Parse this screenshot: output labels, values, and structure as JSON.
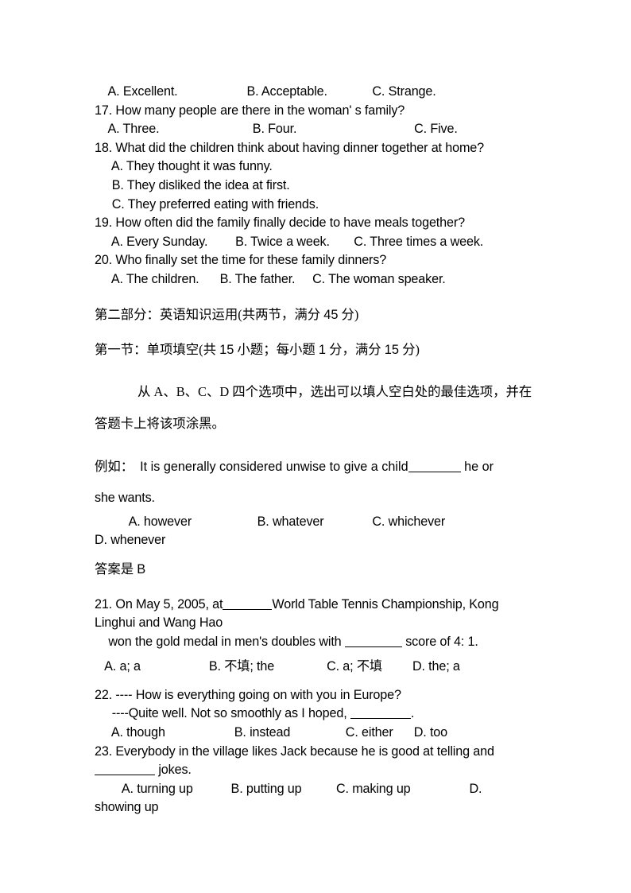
{
  "document": {
    "listening_tail": {
      "q16_options": "    A. Excellent.                    B. Acceptable.             C. Strange.",
      "q17_stem": "17. How many people are there in the woman' s family?",
      "q17_options": "    A. Three.                           B. Four.                                  C. Five.",
      "q18_stem": "18. What did the children think about having dinner together at home?",
      "q18_option_a": "     A. They thought it was funny.",
      "q18_option_b": "     B. They disliked the idea at first.",
      "q18_option_c": "     C. They preferred eating with friends.",
      "q19_stem": "19. How often did the family finally decide to have meals together?",
      "q19_options": "     A. Every Sunday.        B. Twice a week.       C. Three times a week.",
      "q20_stem": "20. Who finally set the time for these family dinners?",
      "q20_options": "     A. The children.      B. The father.     C. The woman speaker."
    },
    "part_two": {
      "heading_cn_1": "第二部分：英语知识运用(共两节，满分 ",
      "heading_num_1": "45",
      "heading_cn_1b": " 分)",
      "section_one_cn_a": "第一节：单项填空(共 ",
      "section_one_num_a": "15",
      "section_one_cn_b": " 小题；每小题 ",
      "section_one_num_b": "1",
      "section_one_cn_c": " 分，满分 ",
      "section_one_num_c": "15",
      "section_one_cn_d": " 分)",
      "instruction_line1": "从 A、B、C、D 四个选项中，选出可以填人空白处的最佳选项，并在",
      "instruction_line2": "答题卡上将该项涂黑。"
    },
    "example": {
      "label_cn": "例如：",
      "stem_before_blank": "It is generally considered unwise to give a child",
      "stem_after_blank": " he or",
      "stem_line2": "she wants.",
      "options": "          A. however                   B. whatever              C. whichever",
      "option_d": "D. whenever",
      "answer_cn": "答案是 ",
      "answer_value": "B"
    },
    "questions": [
      {
        "number": "21.",
        "stem_part1": "21. On May 5, 2005, at",
        "stem_part2": "World Table Tennis Championship, Kong",
        "stem_line2": "Linghui and Wang Hao",
        "stem_line3_before": "    won the gold medal in men's doubles with ",
        "stem_line3_after": " score of 4: 1.",
        "options_a": "   A. a; a",
        "options_b_latin": "B. ",
        "options_b_cn": "不填",
        "options_b_tail": "; the",
        "options_c_latin": "C. a; ",
        "options_c_cn": "不填",
        "options_d": "D. the; a"
      },
      {
        "number": "22.",
        "stem_line1": "22. ---- How is everything going on with you in Europe?",
        "stem_line2_before": "     ----Quite well. Not so smoothly as I hoped, ",
        "stem_line2_after": ".",
        "options": "     A. though                    B. instead                C. either      D. too"
      },
      {
        "number": "23.",
        "stem_line1": "23. Everybody in the village likes Jack because he is good at telling and",
        "stem_line2_after": " jokes.",
        "options": "        A. turning up           B. putting up          C. making up                 D.",
        "options_wrap": "showing up"
      }
    ]
  }
}
